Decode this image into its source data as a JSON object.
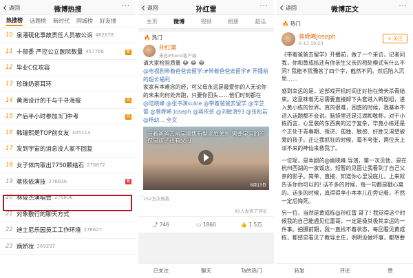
{
  "panel1": {
    "back": "返回",
    "title": "微博热搜",
    "more": "···",
    "tabs": [
      "热搜榜",
      "话题榜",
      "新时代",
      "同城榜",
      "好友搜"
    ],
    "rows": [
      {
        "n": "10",
        "kw": "泉港硫化事故责任人员被公诉",
        "cnt": "462878",
        "flag": "",
        "flagColor": ""
      },
      {
        "n": "11",
        "kw": "十部委 严控公立医院数量",
        "cnt": "457766",
        "flag": "新",
        "flagColor": "#f28c00"
      },
      {
        "n": "12",
        "kw": "毕业C位攻容",
        "cnt": "",
        "flag": "",
        "flagColor": ""
      },
      {
        "n": "13",
        "kw": "珍珠奶茶耳环",
        "cnt": "",
        "flag": "",
        "flagColor": ""
      },
      {
        "n": "14",
        "kw": "黄海设计的千与千寻海报",
        "cnt": "",
        "flag": "热",
        "flagColor": "#f28c00"
      },
      {
        "n": "15",
        "kw": "产后半小时参加3门中考",
        "cnt": "",
        "flag": "热",
        "flagColor": "#f28c00"
      },
      {
        "n": "16",
        "kw": "韩瑞熙是TOP前女友",
        "cnt": "305113",
        "flag": "",
        "flagColor": ""
      },
      {
        "n": "17",
        "kw": "发到宇宙的消息没人家不回复",
        "cnt": "",
        "flag": "",
        "flagColor": ""
      },
      {
        "n": "18",
        "kw": "女子体内取出7750颗结石",
        "cnt": "276872",
        "flag": "",
        "flagColor": ""
      },
      {
        "n": "19",
        "kw": "蒋依依演技",
        "cnt": "276836",
        "flag": "新",
        "flagColor": "#e03b3b"
      },
      {
        "n": "20",
        "kw": "林俊杰演唱会",
        "cnt": "276806",
        "flag": "",
        "flagColor": ""
      },
      {
        "n": "21",
        "kw": "对象敷行的聊天方式",
        "cnt": "",
        "flag": "",
        "flagColor": ""
      },
      {
        "n": "22",
        "kw": "迪士尼乐园员工工作环境",
        "cnt": "276627",
        "flag": "",
        "flagColor": ""
      },
      {
        "n": "23",
        "kw": "病娇妆",
        "cnt": "269297",
        "flag": "",
        "flagColor": ""
      }
    ]
  },
  "panel2": {
    "back": "返回",
    "title": "孙红雷",
    "more": "···",
    "tabs": [
      "主页",
      "微博",
      "视频",
      "相册",
      "超话"
    ],
    "hot": "热门",
    "user": "孙红雷",
    "meta": "来自iPhone客户端",
    "intro": "请大家检验质量 😂 😂 😂",
    "body1": "@电视剧带着爸爸去留学:#带着爸爸去留学# 开播前的超长福利",
    "body2": "家家有本难念的经，可父母永远是最爱你的人无论你的未来向何处奔跑，只要你回头……他们时刻都在",
    "body3": "@陆晓峰 @张书演sukie @带着爸爸去留学 @辛芷蕾 @曾舜晞 Joseph @蒋依依 @刘敏涛93 @张松岩 @杨幼… 全文",
    "video_caption": "带着爸爸去留学聚焦新型家庭关系 需要学习的不仅是孩子还有父母",
    "video_date": "6月13日",
    "views": "252万次观看",
    "like_note": "81人发表了评论",
    "stats": {
      "repost": "746",
      "comment": "1860",
      "like": "1.5万"
    },
    "bottom": [
      "已关注",
      "聊天",
      "Ta的热门"
    ]
  },
  "panel3": {
    "back": "返回",
    "title": "微博正文",
    "more": "···",
    "hot": "热门",
    "user": "曾舜晞Joseph",
    "meta": "6-13 19:23",
    "follow": "+ 关注",
    "paras": [
      "《带着爸爸去留学》开播前，做了一个采访，记者问我，你和黄成栋还有你亲生父亲的相处模式有什么不同? 我能不犹豫答了四个字，截然不同。然后陷入沉思……",
      "感到幸运的是，这部戏开机时间正好抬在倚天杀青结束。这意味着无忌需要直接卸下头套进入新剧组，进入黄小栋的世界。真的很难，困惑的时候，我基本不进入话题都不会说。脑袋里还是江湖和敬称，对于小栋而言，心里装的东西真的过于复杂，毕竟小栋还是个正处于青春期、叛逆、孤独、敏感、好胜又渴望被爱的孩子。正让我抓狂的时候，毫不夸张，两位天上派不来的神仙来救我了。",
      "一位呢，是本剧的@姚晓峰 导演，第一次见他，是在杭州西湖的一家饭店。短暂的见面让我看到了自己父亲的影子。简单、直接、知道你心里没底儿，上来就告诉你你可以的! 话不多的时候，每一句都是戳心窝的。话多的时候，真得得享小本本儿在旁记着，不然一定后悔死。",
      "另一位，当然是黄成栋@孙红雷 哥了! 我觉得这个时候我的自己能遇见红雷哥，一定是极其极其幸运的一件事。拍摄前期，我一直找不着状态，每回看见黄成栋，都感觉看见了教导主任，明明没做坏事，都想要"
    ],
    "bottom": [
      "转发",
      "评论",
      "赞"
    ]
  }
}
